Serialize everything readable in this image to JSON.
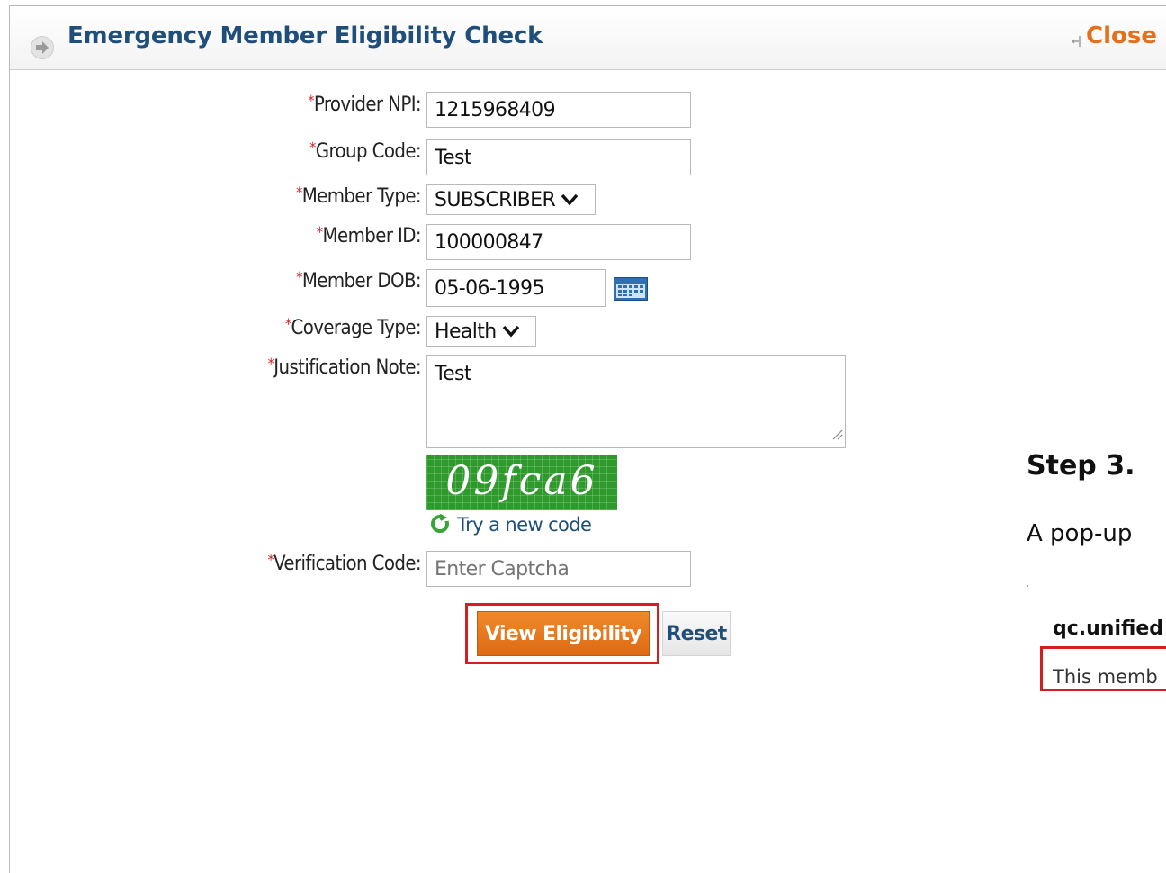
{
  "header": {
    "title": "Emergency Member Eligibility Check",
    "close_label": "Close"
  },
  "form": {
    "fields": [
      {
        "label": "Provider NPI:",
        "value": "1215968409",
        "required": true
      },
      {
        "label": "Group Code:",
        "value": "Test",
        "required": true
      },
      {
        "label": "Member Type:",
        "value": "SUBSCRIBER",
        "required": true
      },
      {
        "label": "Member ID:",
        "value": "100000847",
        "required": true
      },
      {
        "label": "Member DOB:",
        "value": "05-06-1995",
        "required": true
      },
      {
        "label": "Coverage Type:",
        "value": "Health",
        "required": true
      },
      {
        "label": "Justification Note:",
        "value": "Test",
        "required": true
      },
      {
        "label": "Verification Code:",
        "value": "",
        "placeholder": "Enter Captcha",
        "required": true
      }
    ],
    "required_marker": "*",
    "captcha_text": "09fca6",
    "try_new_code_label": "Try a new code",
    "view_eligibility_label": "View Eligibility",
    "reset_label": "Reset"
  },
  "document": {
    "step_heading": "Step 3.",
    "step_text": "A pop-up",
    "dialog_title": "qc.unified",
    "dialog_message": "This memb"
  },
  "colors": {
    "title_blue": "#1f4e7a",
    "close_orange": "#e4701b",
    "required_red": "#d42020",
    "button_orange": "#e57a1f",
    "highlight_red": "#d41f1f",
    "captcha_green": "#2f9a2c"
  },
  "icons": [
    "arrow-right-icon",
    "close-arrow-icon",
    "calendar-icon",
    "refresh-icon",
    "chevron-down-icon",
    "resize-grip-icon"
  ]
}
